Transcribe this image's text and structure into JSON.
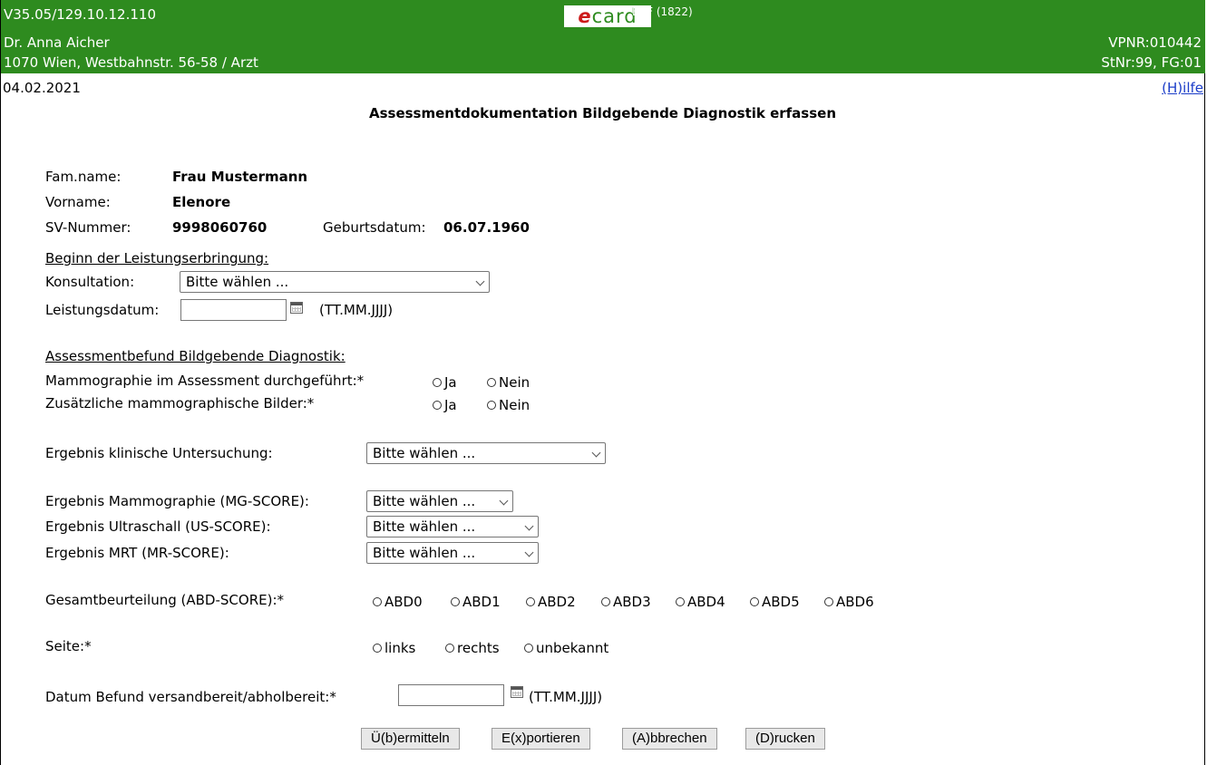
{
  "header": {
    "version": "V35.05/129.10.12.110",
    "logo": {
      "e": "e",
      "rest": "card"
    },
    "bkf": "BKF (1822)",
    "doctor": "Dr. Anna Aicher",
    "vpnr": "VPNR:010442",
    "address": "1070 Wien, Westbahnstr. 56-58 / Arzt",
    "stnr": "StNr:99, FG:01",
    "date": "04.02.2021",
    "help": "(H)ilfe"
  },
  "title": "Assessmentdokumentation Bildgebende Diagnostik erfassen",
  "patient": {
    "famname_label": "Fam.name:",
    "famname": "Frau Mustermann",
    "vorname_label": "Vorname:",
    "vorname": "Elenore",
    "sv_label": "SV-Nummer:",
    "sv": "9998060760",
    "geb_label": "Geburtsdatum:",
    "geb": "06.07.1960"
  },
  "beginn": {
    "heading": "Beginn der Leistungserbringung:",
    "konsultation_label": "Konsultation:",
    "konsultation_value": "Bitte wählen ...",
    "leistungsdatum_label": "Leistungsdatum:",
    "leistungsdatum_value": "",
    "date_format": "(TT.MM.JJJJ)"
  },
  "assessment": {
    "heading": "Assessmentbefund Bildgebende Diagnostik:",
    "mammo_label": "Mammographie im Assessment durchgeführt:*",
    "zusatz_label": "Zusätzliche mammographische Bilder:*",
    "ja": "Ja",
    "nein": "Nein"
  },
  "ergebnis": {
    "klinisch_label": "Ergebnis klinische Untersuchung:",
    "klinisch_value": "Bitte wählen ...",
    "mg_label": "Ergebnis Mammographie (MG-SCORE):",
    "mg_value": "Bitte wählen ...",
    "us_label": "Ergebnis Ultraschall (US-SCORE):",
    "us_value": "Bitte wählen ...",
    "mrt_label": "Ergebnis MRT (MR-SCORE):",
    "mrt_value": "Bitte wählen ..."
  },
  "gesamt": {
    "label": "Gesamtbeurteilung (ABD-SCORE):*",
    "options": [
      "ABD0",
      "ABD1",
      "ABD2",
      "ABD3",
      "ABD4",
      "ABD5",
      "ABD6"
    ]
  },
  "seite": {
    "label": "Seite:*",
    "options": [
      "links",
      "rechts",
      "unbekannt"
    ]
  },
  "befund": {
    "label": "Datum Befund versandbereit/abholbereit:*",
    "value": "",
    "date_format": "(TT.MM.JJJJ)"
  },
  "buttons": {
    "submit": "Ü(b)ermitteln",
    "export": "E(x)portieren",
    "cancel": "(A)bbrechen",
    "print": "(D)rucken"
  }
}
